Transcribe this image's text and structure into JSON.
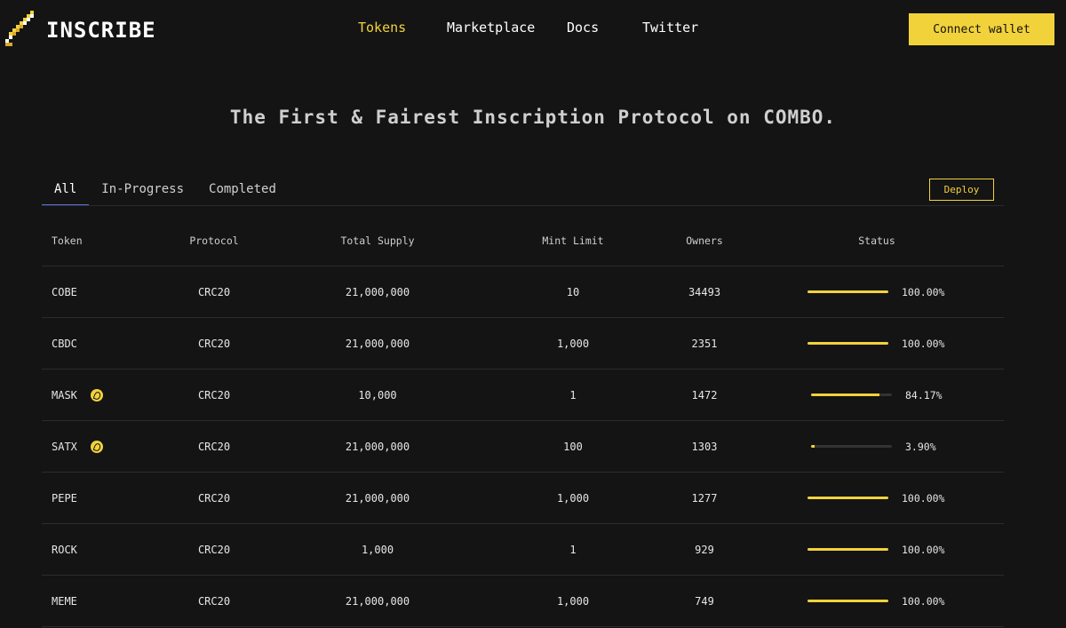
{
  "brand": {
    "name": "INSCRIBE",
    "accent_color": "#f2d23b"
  },
  "nav": {
    "items": [
      {
        "label": "Tokens",
        "active": true
      },
      {
        "label": "Marketplace",
        "active": false
      },
      {
        "label": "Docs",
        "active": false
      },
      {
        "label": "Twitter",
        "active": false
      }
    ],
    "connect_label": "Connect wallet"
  },
  "hero": {
    "title": "The First & Fairest Inscription Protocol on COMBO."
  },
  "tabs": [
    {
      "label": "All",
      "active": true
    },
    {
      "label": "In-Progress",
      "active": false
    },
    {
      "label": "Completed",
      "active": false
    }
  ],
  "deploy_label": "Deploy",
  "table": {
    "columns": [
      "Token",
      "Protocol",
      "Total Supply",
      "Mint Limit",
      "Owners",
      "Status"
    ],
    "rows": [
      {
        "token": "COBE",
        "icon": null,
        "protocol": "CRC20",
        "supply": "21,000,000",
        "mint": "10",
        "owners": "34493",
        "progress": 100,
        "pct": "100.00%"
      },
      {
        "token": "CBDC",
        "icon": null,
        "protocol": "CRC20",
        "supply": "21,000,000",
        "mint": "1,000",
        "owners": "2351",
        "progress": 100,
        "pct": "100.00%"
      },
      {
        "token": "MASK",
        "icon": "coin-icon",
        "protocol": "CRC20",
        "supply": "10,000",
        "mint": "1",
        "owners": "1472",
        "progress": 84.17,
        "pct": "84.17%"
      },
      {
        "token": "SATX",
        "icon": "coin-icon",
        "protocol": "CRC20",
        "supply": "21,000,000",
        "mint": "100",
        "owners": "1303",
        "progress": 3.9,
        "pct": "3.90%"
      },
      {
        "token": "PEPE",
        "icon": null,
        "protocol": "CRC20",
        "supply": "21,000,000",
        "mint": "1,000",
        "owners": "1277",
        "progress": 100,
        "pct": "100.00%"
      },
      {
        "token": "ROCK",
        "icon": null,
        "protocol": "CRC20",
        "supply": "1,000",
        "mint": "1",
        "owners": "929",
        "progress": 100,
        "pct": "100.00%"
      },
      {
        "token": "MEME",
        "icon": null,
        "protocol": "CRC20",
        "supply": "21,000,000",
        "mint": "1,000",
        "owners": "749",
        "progress": 100,
        "pct": "100.00%"
      }
    ]
  }
}
